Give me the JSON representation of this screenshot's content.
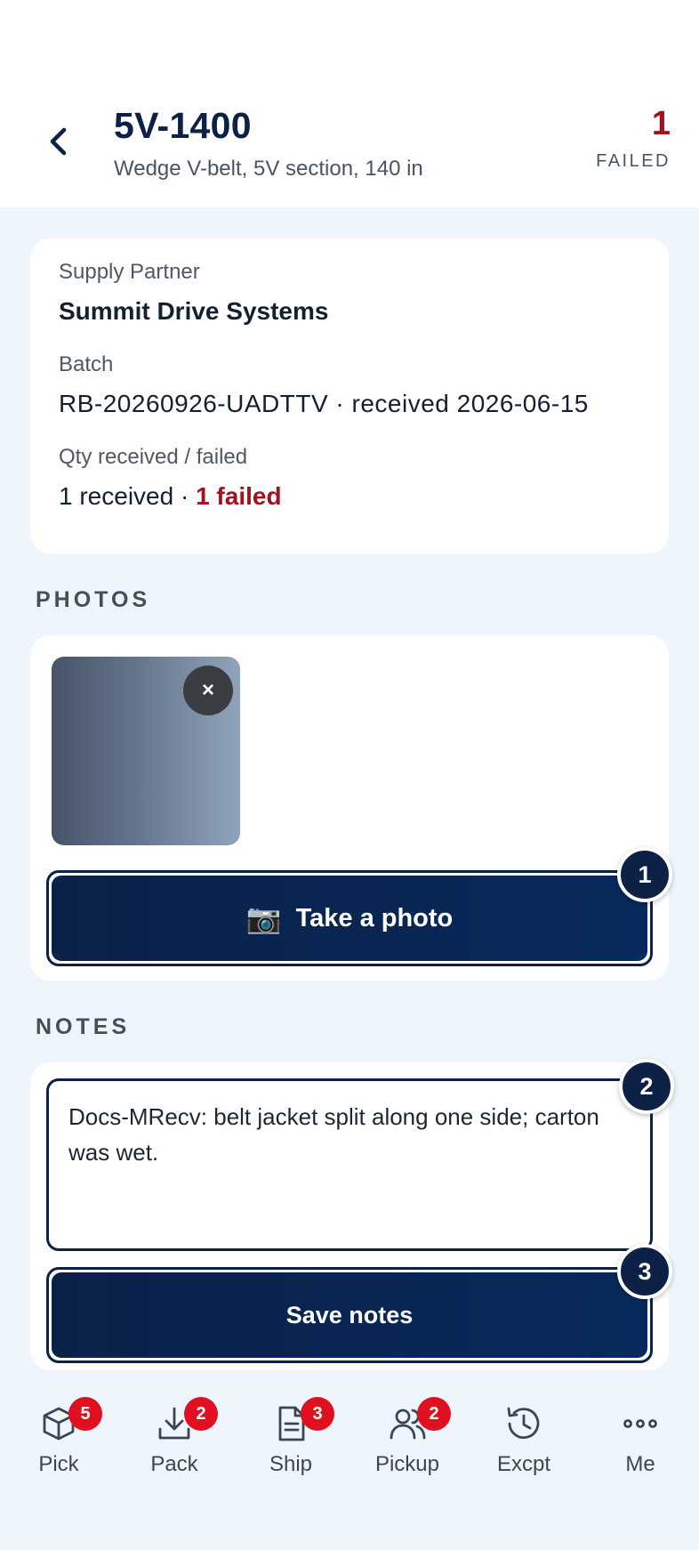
{
  "header": {
    "title": "5V-1400",
    "subtitle": "Wedge V-belt, 5V section, 140 in",
    "failed_count": "1",
    "failed_label": "FAILED"
  },
  "info": {
    "supplier_label": "Supply Partner",
    "supplier_value": "Summit Drive Systems",
    "batch_label": "Batch",
    "batch_value": "RB-20260926-UADTTV · received 2026-06-15",
    "qty_label": "Qty received / failed",
    "qty_received": "1 received · ",
    "qty_failed": "1 failed"
  },
  "photos": {
    "heading": "PHOTOS",
    "remove_glyph": "×",
    "take_photo_label": "Take a photo",
    "camera_glyph": "📷"
  },
  "notes": {
    "heading": "NOTES",
    "text": "Docs-MRecv: belt jacket split along one side; carton was wet.",
    "save_label": "Save notes"
  },
  "markers": {
    "m1": "1",
    "m2": "2",
    "m3": "3"
  },
  "nav": {
    "items": [
      {
        "label": "Pick",
        "badge": "5",
        "icon": "box-icon"
      },
      {
        "label": "Pack",
        "badge": "2",
        "icon": "download-icon"
      },
      {
        "label": "Ship",
        "badge": "3",
        "icon": "document-icon"
      },
      {
        "label": "Pickup",
        "badge": "2",
        "icon": "users-icon"
      },
      {
        "label": "Excpt",
        "badge": "",
        "icon": "history-icon"
      },
      {
        "label": "Me",
        "badge": "",
        "icon": "more-icon"
      }
    ]
  },
  "colors": {
    "primary": "#0b2148",
    "danger": "#a1121c",
    "badge": "#e01021",
    "background": "#eef5fc"
  }
}
